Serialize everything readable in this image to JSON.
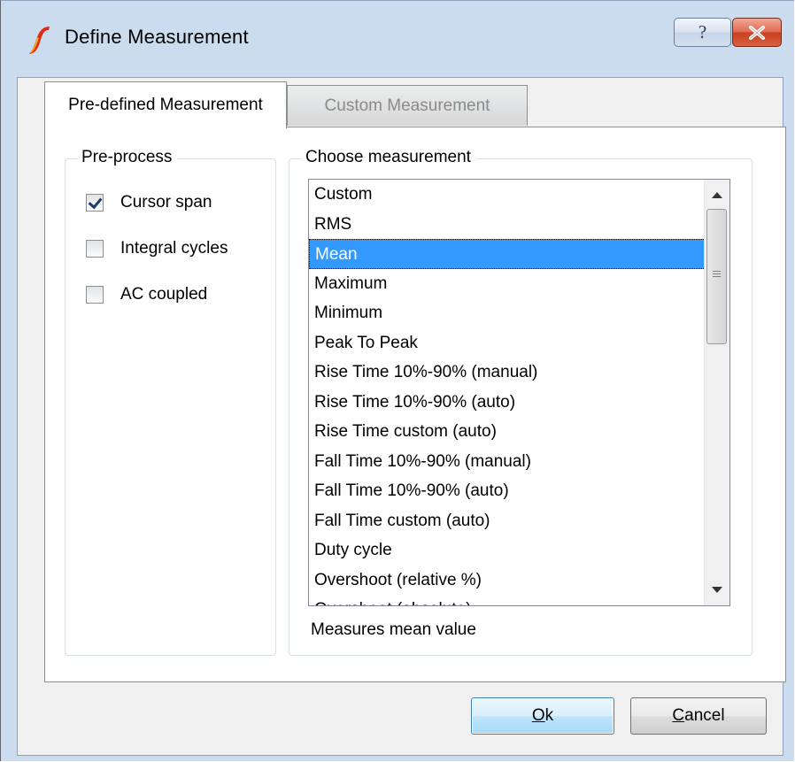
{
  "window": {
    "title": "Define Measurement",
    "help_label": "?"
  },
  "tabs": [
    {
      "label": "Pre-defined Measurement",
      "active": true
    },
    {
      "label": "Custom Measurement",
      "active": false
    }
  ],
  "preprocess": {
    "label": "Pre-process",
    "options": [
      {
        "label": "Cursor span",
        "checked": true
      },
      {
        "label": "Integral cycles",
        "checked": false
      },
      {
        "label": "AC coupled",
        "checked": false
      }
    ]
  },
  "measurement": {
    "label": "Choose measurement",
    "items": [
      "Custom",
      "RMS",
      "Mean",
      "Maximum",
      "Minimum",
      "Peak To Peak",
      "Rise Time 10%-90% (manual)",
      "Rise Time 10%-90% (auto)",
      "Rise Time custom (auto)",
      "Fall Time 10%-90% (manual)",
      "Fall Time 10%-90% (auto)",
      "Fall Time custom (auto)",
      "Duty cycle",
      "Overshoot (relative %)",
      "Overshoot (absolute)"
    ],
    "selected": "Mean",
    "description": "Measures mean value"
  },
  "buttons": {
    "ok": {
      "mnemonic": "O",
      "rest": "k"
    },
    "cancel": {
      "mnemonic": "C",
      "rest": "ancel"
    }
  },
  "colors": {
    "selection": "#3399ff",
    "frame": "#cbdcee",
    "close_button": "#c9401f"
  }
}
